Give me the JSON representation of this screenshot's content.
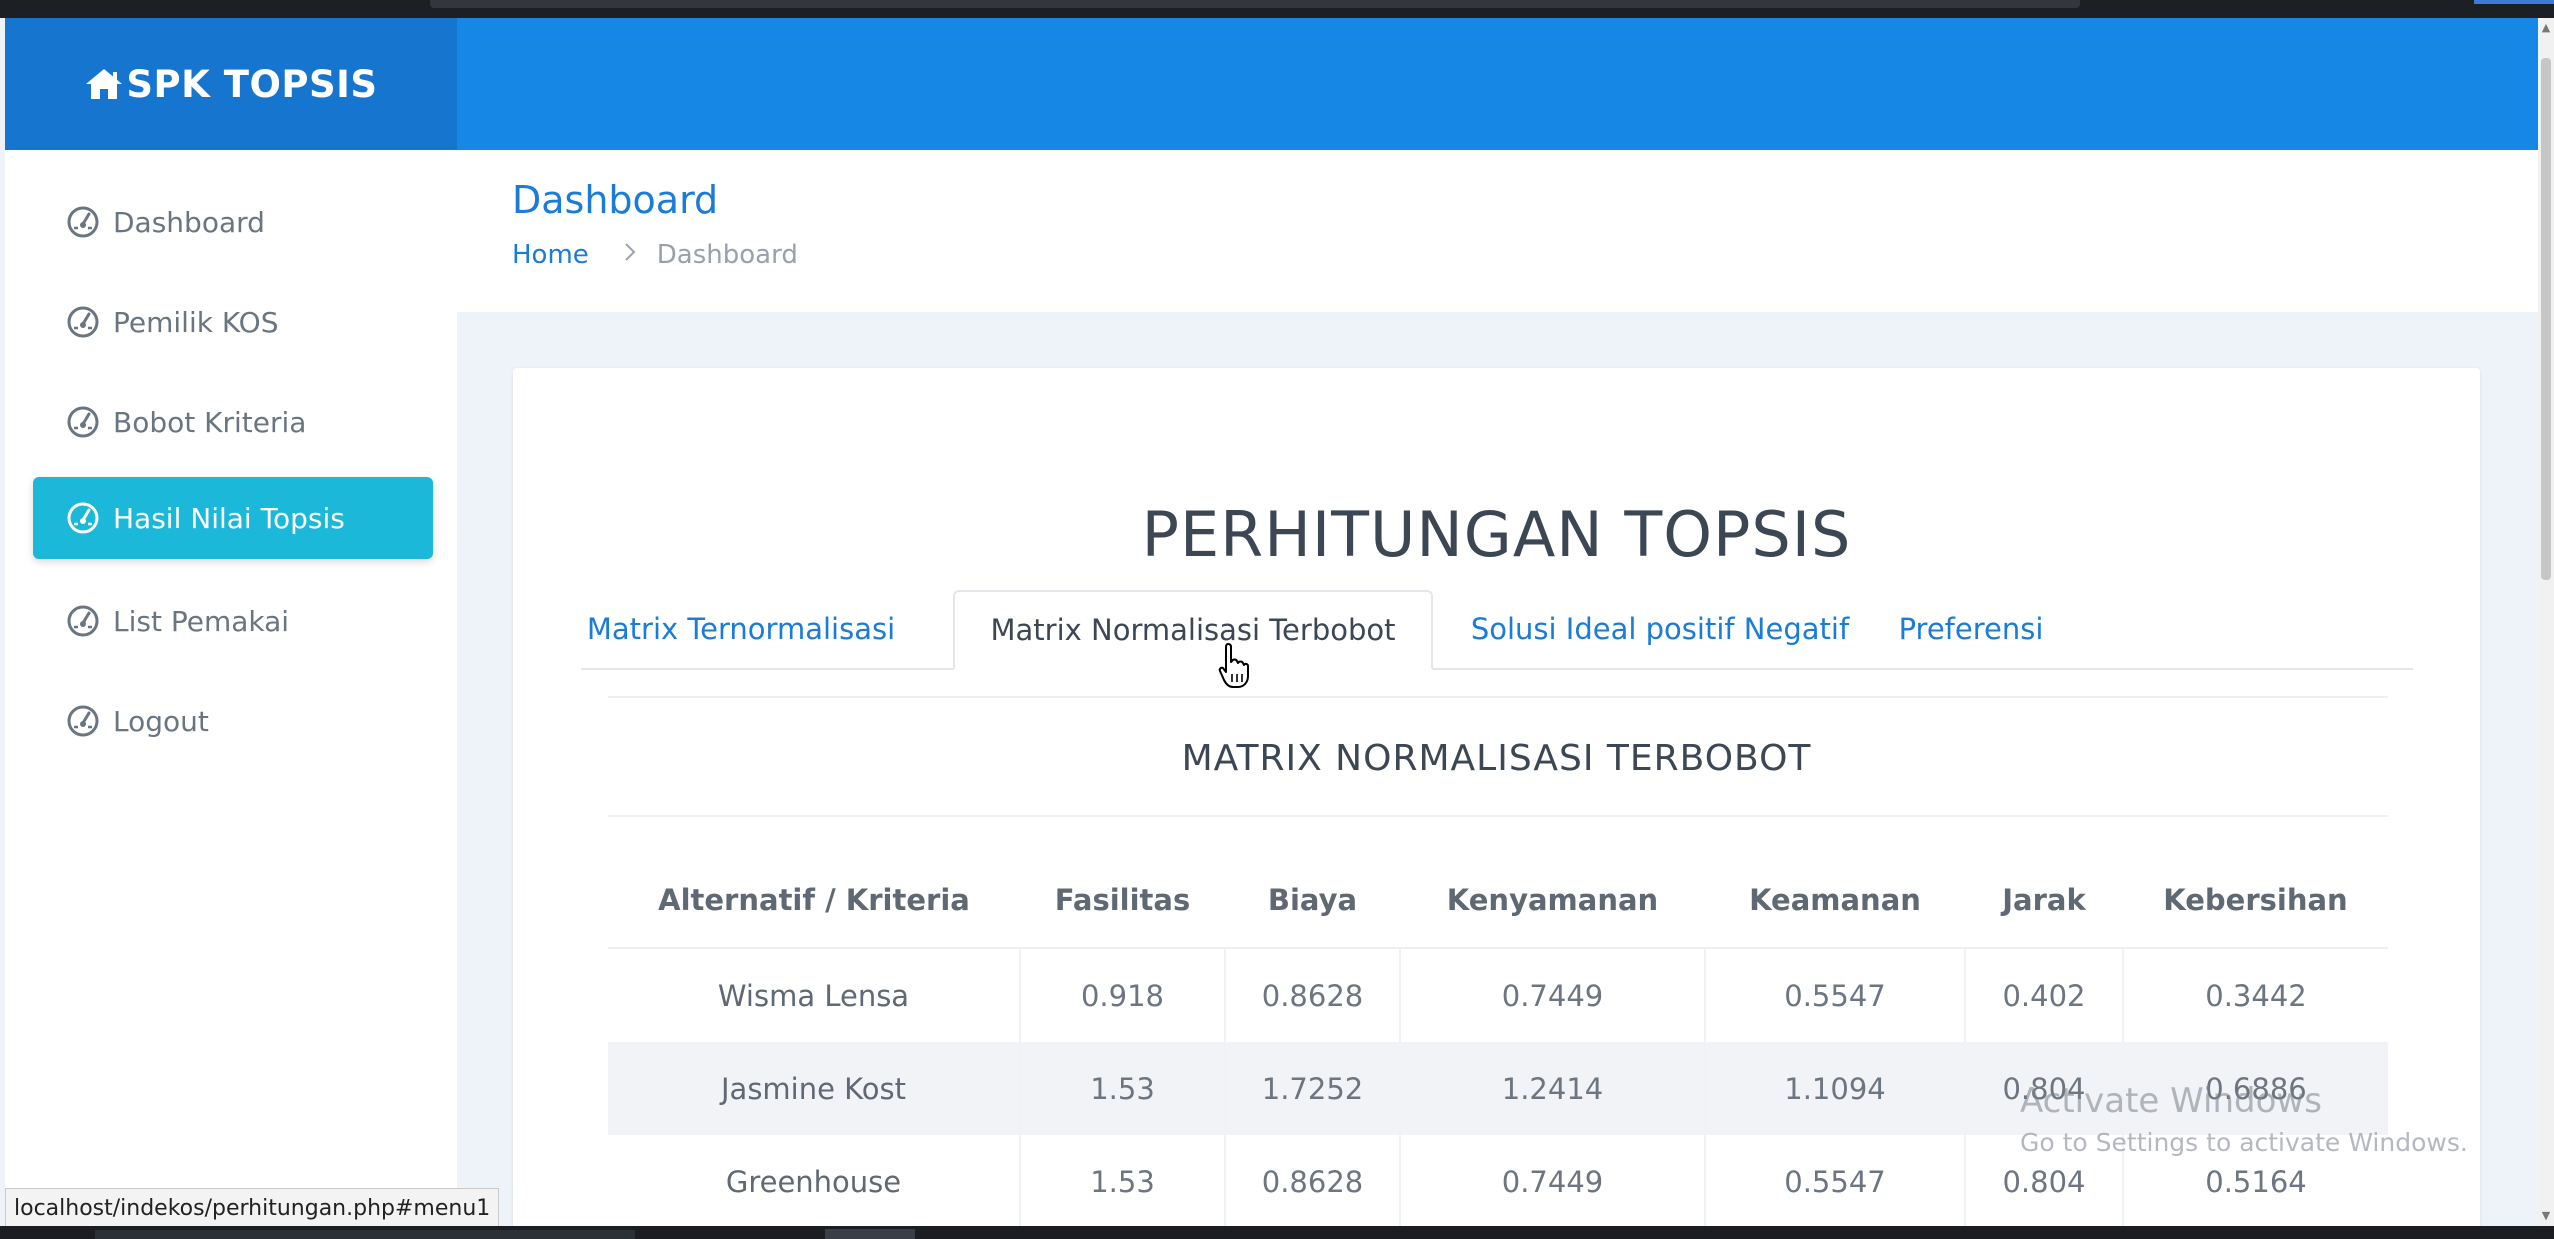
{
  "brand": {
    "name": "SPK TOPSIS",
    "icon": "home-icon"
  },
  "sidebar": {
    "items": [
      {
        "label": "Dashboard",
        "icon": "speedometer-icon",
        "active": false
      },
      {
        "label": "Pemilik KOS",
        "icon": "speedometer-icon",
        "active": false
      },
      {
        "label": "Bobot Kriteria",
        "icon": "speedometer-icon",
        "active": false
      },
      {
        "label": "Hasil Nilai Topsis",
        "icon": "speedometer-icon",
        "active": true
      },
      {
        "label": "List Pemakai",
        "icon": "speedometer-icon",
        "active": false
      },
      {
        "label": "Logout",
        "icon": "speedometer-icon",
        "active": false
      }
    ]
  },
  "page": {
    "title": "Dashboard",
    "breadcrumb": {
      "home": "Home",
      "separator": ">",
      "current": "Dashboard"
    }
  },
  "content": {
    "title": "PERHITUNGAN TOPSIS",
    "tabs": [
      {
        "label": "Matrix Ternormalisasi",
        "active": false
      },
      {
        "label": "Matrix Normalisasi Terbobot",
        "active": true
      },
      {
        "label": "Solusi Ideal positif Negatif",
        "active": false
      },
      {
        "label": "Preferensi",
        "active": false
      }
    ],
    "section_title": "MATRIX NORMALISASI TERBOBOT",
    "table": {
      "headers": [
        "Alternatif / Kriteria",
        "Fasilitas",
        "Biaya",
        "Kenyamanan",
        "Keamanan",
        "Jarak",
        "Kebersihan"
      ],
      "rows": [
        [
          "Wisma Lensa",
          "0.918",
          "0.8628",
          "0.7449",
          "0.5547",
          "0.402",
          "0.3442"
        ],
        [
          "Jasmine Kost",
          "1.53",
          "1.7252",
          "1.2414",
          "1.1094",
          "0.804",
          "0.6886"
        ],
        [
          "Greenhouse",
          "1.53",
          "0.8628",
          "0.7449",
          "0.5547",
          "0.804",
          "0.5164"
        ]
      ]
    }
  },
  "watermark": {
    "line1": "Activate Windows",
    "line2": "Go to Settings to activate Windows."
  },
  "status_url": "localhost/indekos/perhitungan.php#menu1",
  "colors": {
    "header": "#1787e6",
    "brand_bg": "#1676cf",
    "active_nav": "#1cb8d9",
    "link": "#1a7cd7"
  }
}
